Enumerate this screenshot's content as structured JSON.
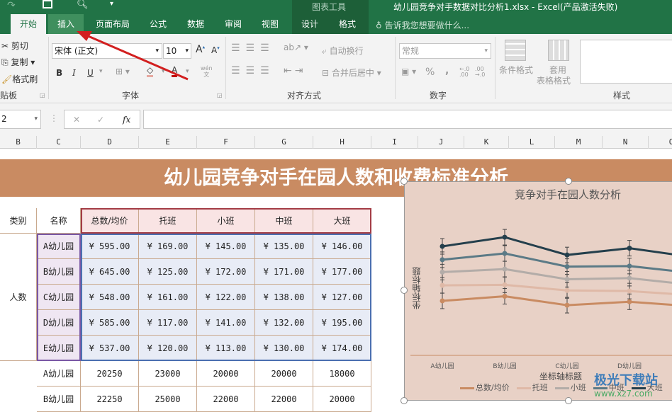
{
  "titlebar": {
    "context_group": "图表工具",
    "title": "幼儿园竞争对手数据对比分析1.xlsx - Excel(产品激活失败)",
    "tell_me": "告诉我您想要做什么..."
  },
  "tabs": [
    {
      "label": "开始"
    },
    {
      "label": "插入"
    },
    {
      "label": "页面布局"
    },
    {
      "label": "公式"
    },
    {
      "label": "数据"
    },
    {
      "label": "审阅"
    },
    {
      "label": "视图"
    },
    {
      "label": "设计"
    },
    {
      "label": "格式"
    }
  ],
  "ribbon": {
    "clipboard": {
      "cut": "剪切",
      "copy": "复制",
      "painter": "格式刷",
      "label": "贴板"
    },
    "font": {
      "name": "宋体 (正文)",
      "size": "10",
      "bold": "B",
      "italic": "I",
      "underline": "U",
      "label": "字体",
      "phonetic": "wén"
    },
    "align": {
      "wrap": "自动换行",
      "merge": "合并后居中",
      "label": "对齐方式"
    },
    "number": {
      "format": "常规",
      "percent": "%",
      "comma": ",",
      "label": "数字"
    },
    "styles": {
      "cond": "条件格式",
      "table1": "套用",
      "table2": "表格格式",
      "label": "样式"
    }
  },
  "formula": {
    "namebox": "2",
    "fx": "fx",
    "cancel": "✕",
    "enter": "✓"
  },
  "columns": [
    "B",
    "C",
    "D",
    "E",
    "F",
    "G",
    "H",
    "I",
    "J",
    "K",
    "L",
    "M",
    "N",
    "O"
  ],
  "sheet": {
    "banner": "幼儿园竞争对手在园人数和收费标准分析",
    "headers": [
      "类别",
      "名称",
      "总数/均价",
      "托班",
      "小班",
      "中班",
      "大班"
    ],
    "category": "人数",
    "rows": [
      [
        "A幼儿园",
        "¥ 595.00",
        "¥ 169.00",
        "¥ 145.00",
        "¥ 135.00",
        "¥ 146.00"
      ],
      [
        "B幼儿园",
        "¥ 645.00",
        "¥ 125.00",
        "¥ 172.00",
        "¥ 171.00",
        "¥ 177.00"
      ],
      [
        "C幼儿园",
        "¥ 548.00",
        "¥ 161.00",
        "¥ 122.00",
        "¥ 138.00",
        "¥ 127.00"
      ],
      [
        "D幼儿园",
        "¥ 585.00",
        "¥ 117.00",
        "¥ 141.00",
        "¥ 132.00",
        "¥ 195.00"
      ],
      [
        "E幼儿园",
        "¥ 537.00",
        "¥ 120.00",
        "¥ 113.00",
        "¥ 130.00",
        "¥ 174.00"
      ]
    ],
    "rows2": [
      [
        "A幼儿园",
        "20250",
        "23000",
        "20000",
        "20000",
        "18000"
      ],
      [
        "B幼儿园",
        "22250",
        "25000",
        "22000",
        "22000",
        "20000"
      ]
    ]
  },
  "chart_data": {
    "type": "line",
    "stacked": true,
    "title": "竞争对手在园人数分析",
    "xlabel": "坐标轴标题",
    "ylabel": "坐标轴标题",
    "categories": [
      "A幼儿园",
      "B幼儿园",
      "C幼儿园",
      "D幼儿园",
      "E幼儿园"
    ],
    "ylim": [
      0,
      1800
    ],
    "series": [
      {
        "name": "总数/均价",
        "color": "#c98b62",
        "values": [
          595,
          645,
          548,
          585,
          537
        ]
      },
      {
        "name": "托班",
        "color": "#dfb9a7",
        "values": [
          169,
          125,
          161,
          117,
          120
        ]
      },
      {
        "name": "小班",
        "color": "#b3aca8",
        "values": [
          145,
          172,
          122,
          141,
          113
        ]
      },
      {
        "name": "中班",
        "color": "#5b7a86",
        "values": [
          135,
          171,
          138,
          132,
          130
        ]
      },
      {
        "name": "大班",
        "color": "#243f4c",
        "values": [
          146,
          177,
          127,
          195,
          174
        ]
      }
    ],
    "error_bars": true
  },
  "watermark": {
    "cn": "极光下载站",
    "url": "www.xz7.com"
  }
}
